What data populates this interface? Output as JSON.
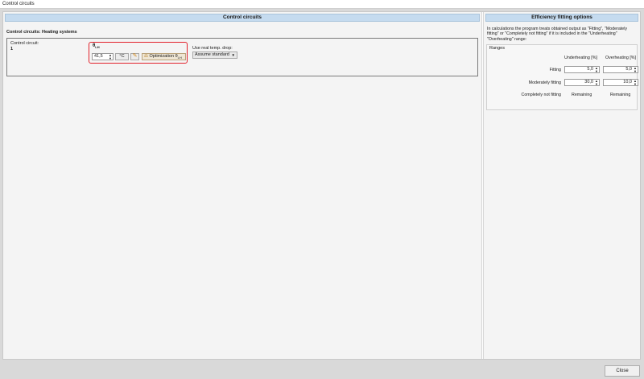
{
  "window": {
    "title": "Control circuits"
  },
  "left": {
    "header": "Control circuits",
    "subheading": "Control circuits: Heating systems",
    "circuit": {
      "label": "Control circuit:",
      "number": "1",
      "theta_symbol": "θ",
      "theta_sub": "LH",
      "temp_value": "41,5",
      "unit_button": "°C",
      "pencil_icon": "pencil-icon",
      "optimization_label": "Optimization θ",
      "optimization_sub": "LH",
      "temp_drop_label": "Use real temp. drop:",
      "temp_drop_value": "Assume standard"
    }
  },
  "right": {
    "header": "Efficiency fitting options",
    "description": "In calculations the program treats obtained output as \"Fitting\", \"Moderately fitting\" or \"Completely not fitting\" if it is included in the \"Underheating\" \"Overheating\" range:",
    "ranges_title": "Ranges",
    "col_under": "Underheating [%]",
    "col_over": "Overheating [%]",
    "rows": [
      {
        "label": "Fitting",
        "under": "5,0",
        "over": "5,0"
      },
      {
        "label": "Moderately fitting",
        "under": "30,0",
        "over": "10,0"
      },
      {
        "label": "Completely not fitting",
        "under": "Remaining",
        "over": "Remaining"
      }
    ]
  },
  "footer": {
    "close_label": "Close"
  },
  "colors": {
    "header_bg": "#c5dbef",
    "highlight": "#e2212b"
  }
}
